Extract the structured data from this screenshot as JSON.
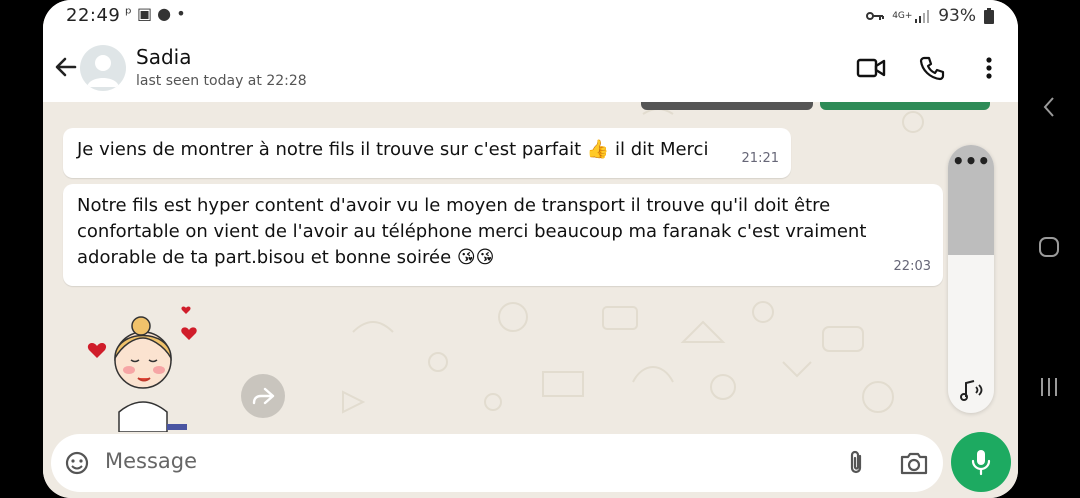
{
  "status": {
    "time": "22:49",
    "battery": "93%",
    "network": "4G+"
  },
  "contact": {
    "name": "Sadia",
    "last_seen": "last seen today at 22:28"
  },
  "messages": [
    {
      "text": "Je viens de montrer à notre fils il trouve sur c'est parfait 👍 il dit Merci",
      "time": "21:21"
    },
    {
      "text": "Notre fils est hyper content d'avoir vu le moyen de transport il trouve qu'il doit être confortable on vient de l'avoir au téléphone merci beaucoup ma faranak c'est vraiment adorable de ta part.bisou et bonne soirée 😘😘",
      "time": "22:03"
    }
  ],
  "composer": {
    "placeholder": "Message"
  },
  "colors": {
    "accent": "#1daa61",
    "chat_bg": "#efeae2",
    "bubble": "#ffffff"
  },
  "icons": [
    "back-arrow-icon",
    "video-call-icon",
    "phone-call-icon",
    "more-options-icon",
    "forward-icon",
    "emoji-sticker-icon",
    "attach-icon",
    "camera-icon",
    "mic-icon",
    "audio-icon"
  ]
}
